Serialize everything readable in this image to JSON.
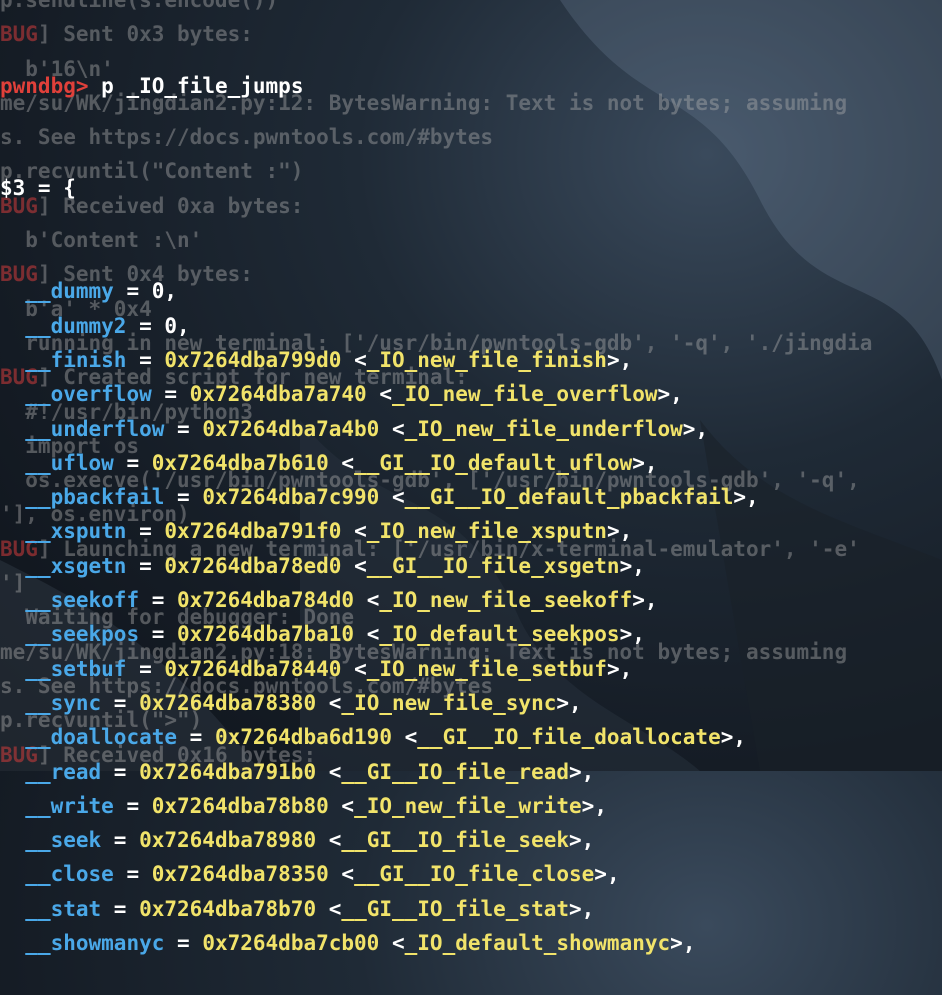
{
  "prompt": "pwndbg>",
  "command": "p _IO_file_jumps",
  "result_header": "$3 = {",
  "fields": [
    {
      "name": "__dummy",
      "value": "0",
      "symbol": ""
    },
    {
      "name": "__dummy2",
      "value": "0",
      "symbol": ""
    },
    {
      "name": "__finish",
      "value": "0x7264dba799d0",
      "symbol": "<_IO_new_file_finish>"
    },
    {
      "name": "__overflow",
      "value": "0x7264dba7a740",
      "symbol": "<_IO_new_file_overflow>"
    },
    {
      "name": "__underflow",
      "value": "0x7264dba7a4b0",
      "symbol": "<_IO_new_file_underflow>"
    },
    {
      "name": "__uflow",
      "value": "0x7264dba7b610",
      "symbol": "<__GI__IO_default_uflow>"
    },
    {
      "name": "__pbackfail",
      "value": "0x7264dba7c990",
      "symbol": "<__GI__IO_default_pbackfail>"
    },
    {
      "name": "__xsputn",
      "value": "0x7264dba791f0",
      "symbol": "<_IO_new_file_xsputn>"
    },
    {
      "name": "__xsgetn",
      "value": "0x7264dba78ed0",
      "symbol": "<__GI__IO_file_xsgetn>"
    },
    {
      "name": "__seekoff",
      "value": "0x7264dba784d0",
      "symbol": "<_IO_new_file_seekoff>"
    },
    {
      "name": "__seekpos",
      "value": "0x7264dba7ba10",
      "symbol": "<_IO_default_seekpos>"
    },
    {
      "name": "__setbuf",
      "value": "0x7264dba78440",
      "symbol": "<_IO_new_file_setbuf>"
    },
    {
      "name": "__sync",
      "value": "0x7264dba78380",
      "symbol": "<_IO_new_file_sync>"
    },
    {
      "name": "__doallocate",
      "value": "0x7264dba6d190",
      "symbol": "<__GI__IO_file_doallocate>"
    },
    {
      "name": "__read",
      "value": "0x7264dba791b0",
      "symbol": "<__GI__IO_file_read>"
    },
    {
      "name": "__write",
      "value": "0x7264dba78b80",
      "symbol": "<_IO_new_file_write>"
    },
    {
      "name": "__seek",
      "value": "0x7264dba78980",
      "symbol": "<__GI__IO_file_seek>"
    },
    {
      "name": "__close",
      "value": "0x7264dba78350",
      "symbol": "<__GI__IO_file_close>"
    },
    {
      "name": "__stat",
      "value": "0x7264dba78b70",
      "symbol": "<__GI__IO_file_stat>"
    },
    {
      "name": "__showmanyc",
      "value": "0x7264dba7cb00",
      "symbol": "<_IO_default_showmanyc>"
    }
  ],
  "background_text": [
    {
      "tag": "",
      "text": "p.sendline(s.encode())"
    },
    {
      "tag": "BUG",
      "text": "] Sent 0x3 bytes:"
    },
    {
      "tag": "",
      "text": "  b'16\\n'"
    },
    {
      "tag": "",
      "text": "me/su/WK/jingdian2.py:12: BytesWarning: Text is not bytes; assuming"
    },
    {
      "tag": "",
      "text": "s. See https://docs.pwntools.com/#bytes"
    },
    {
      "tag": "",
      "text": "p.recvuntil(\"Content :\")"
    },
    {
      "tag": "BUG",
      "text": "] Received 0xa bytes:"
    },
    {
      "tag": "",
      "text": "  b'Content :\\n'"
    },
    {
      "tag": "BUG",
      "text": "] Sent 0x4 bytes:"
    },
    {
      "tag": "",
      "text": "  b'a' * 0x4"
    },
    {
      "tag": "",
      "text": "  running in new terminal: ['/usr/bin/pwntools-gdb', '-q', './jingdia"
    },
    {
      "tag": "BUG",
      "text": "] Created script for new terminal:"
    },
    {
      "tag": "",
      "text": "  #!/usr/bin/python3"
    },
    {
      "tag": "",
      "text": "  import os"
    },
    {
      "tag": "",
      "text": "  os.execve('/usr/bin/pwntools-gdb', ['/usr/bin/pwntools-gdb', '-q',"
    },
    {
      "tag": "",
      "text": "'], os.environ)"
    },
    {
      "tag": "BUG",
      "text": "] Launching a new terminal: ['/usr/bin/x-terminal-emulator', '-e'"
    },
    {
      "tag": "",
      "text": "']"
    },
    {
      "tag": "",
      "text": "  Waiting for debugger: Done"
    },
    {
      "tag": "",
      "text": "me/su/WK/jingdian2.py:18: BytesWarning: Text is not bytes; assuming"
    },
    {
      "tag": "",
      "text": "s. See https://docs.pwntools.com/#bytes"
    },
    {
      "tag": "",
      "text": "p.recvuntil(\">\")"
    },
    {
      "tag": "BUG",
      "text": "] Received 0x16 bytes:"
    }
  ],
  "colors": {
    "prompt": "#e0403a",
    "field": "#4aa8e8",
    "address": "#f1e36a",
    "symbol": "#f1e36a",
    "text": "#ffffff"
  }
}
